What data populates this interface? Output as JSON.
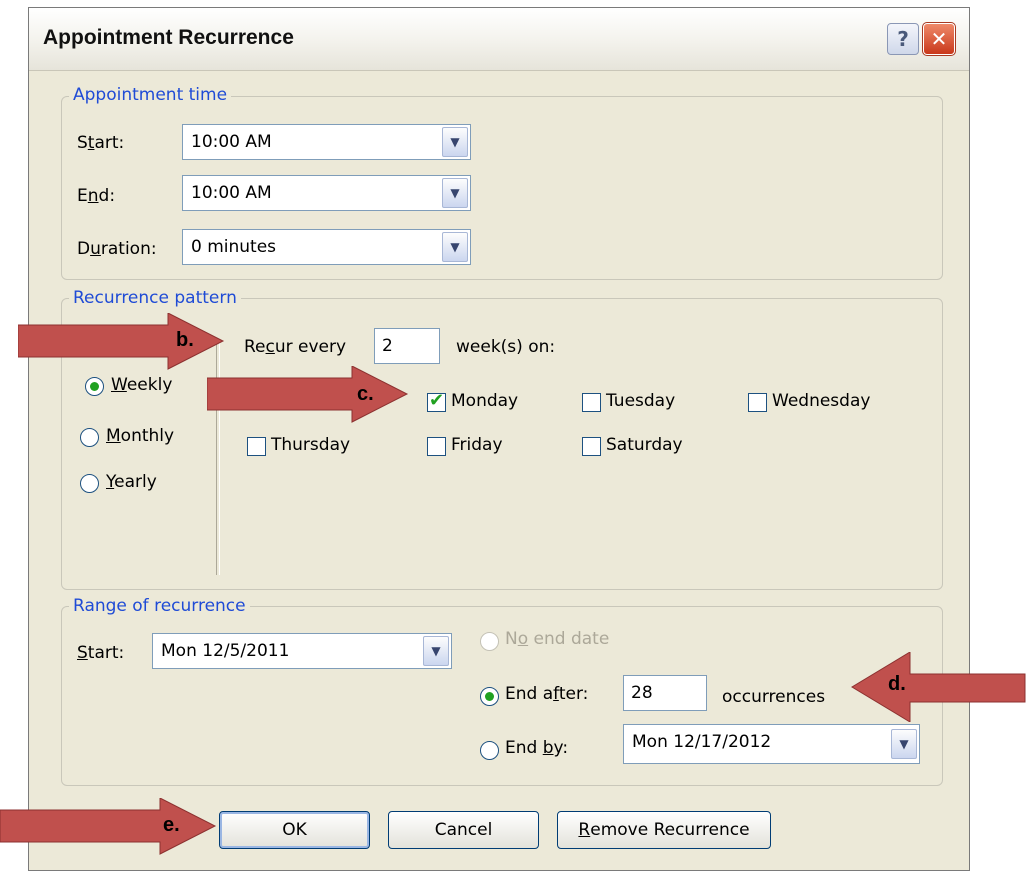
{
  "dialog": {
    "title": "Appointment Recurrence",
    "help_glyph": "?",
    "close_glyph": "✕"
  },
  "appointment_time": {
    "legend": "Appointment time",
    "start_label": "Start:",
    "start_value": "10:00 AM",
    "end_label": "End:",
    "end_value": "10:00 AM",
    "duration_label": "Duration:",
    "duration_value": "0 minutes"
  },
  "recurrence_pattern": {
    "legend": "Recurrence pattern",
    "frequencies": [
      {
        "label": "Weekly",
        "selected": true
      },
      {
        "label": "Monthly",
        "selected": false
      },
      {
        "label": "Yearly",
        "selected": false
      }
    ],
    "recur_every_label": "Recur every",
    "recur_every_value": "2",
    "weeks_on_label": "week(s) on:",
    "days": [
      {
        "label": "Monday",
        "checked": true
      },
      {
        "label": "Tuesday",
        "checked": false
      },
      {
        "label": "Wednesday",
        "checked": false
      },
      {
        "label": "Thursday",
        "checked": false
      },
      {
        "label": "Friday",
        "checked": false
      },
      {
        "label": "Saturday",
        "checked": false
      }
    ]
  },
  "range": {
    "legend": "Range of recurrence",
    "start_label": "Start:",
    "start_value": "Mon 12/5/2011",
    "no_end_label": "No end date",
    "end_after_label": "End after:",
    "end_after_value": "28",
    "occurrences_label": "occurrences",
    "end_by_label": "End by:",
    "end_by_value": "Mon 12/17/2012",
    "selected": "end_after"
  },
  "buttons": {
    "ok": "OK",
    "cancel": "Cancel",
    "remove": "Remove Recurrence"
  },
  "annotations": {
    "b": "b.",
    "c": "c.",
    "d": "d.",
    "e": "e.",
    "arrow_color": "#c0504d"
  },
  "icons": {
    "dropdown": "chevron-down-icon",
    "check": "check-icon",
    "help": "help-icon",
    "close": "close-icon"
  }
}
